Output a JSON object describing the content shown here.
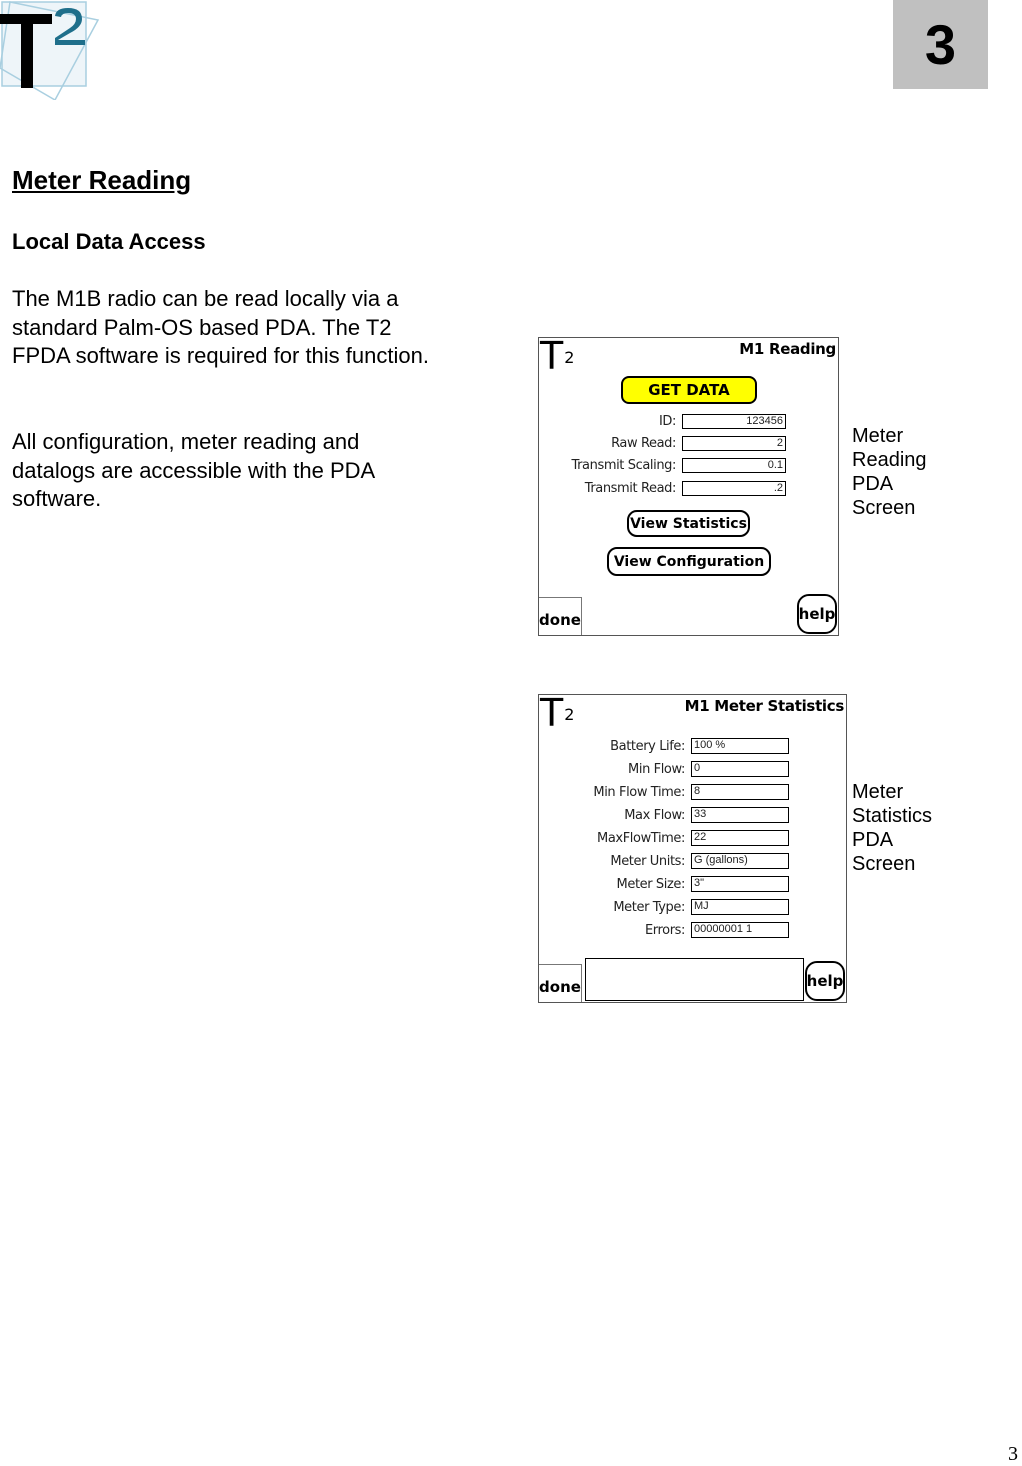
{
  "header": {
    "logo_text": "T",
    "logo_superscript": "2",
    "chapter_number": "3"
  },
  "section": {
    "title": "Meter Reading",
    "subtitle": "Local Data Access",
    "paragraphs": [
      "The M1B radio can be read locally via a standard Palm-OS based PDA. The T2 FPDA software is required for this function.",
      "All configuration, meter reading and datalogs are accessible with the PDA software."
    ]
  },
  "reading_screen": {
    "logo_text": "T",
    "logo_superscript": "2",
    "title": "M1 Reading",
    "get_data_label": "GET DATA",
    "fields": [
      {
        "label": "ID:",
        "value": "123456"
      },
      {
        "label": "Raw Read:",
        "value": "2"
      },
      {
        "label": "Transmit Scaling:",
        "value": "0.1"
      },
      {
        "label": "Transmit Read:",
        "value": ".2"
      }
    ],
    "view_statistics_label": "View Statistics",
    "view_configuration_label": "View Configuration",
    "done_label": "done",
    "help_label": "help",
    "caption": [
      "Meter",
      "Reading",
      "PDA",
      "Screen"
    ]
  },
  "statistics_screen": {
    "logo_text": "T",
    "logo_superscript": "2",
    "title": "M1 Meter Statistics",
    "fields": [
      {
        "label": "Battery Life:",
        "value": "100 %"
      },
      {
        "label": "Min Flow:",
        "value": " 0"
      },
      {
        "label": "Min Flow Time:",
        "value": " 8"
      },
      {
        "label": "Max Flow:",
        "value": " 33"
      },
      {
        "label": "MaxFlowTime:",
        "value": " 22"
      },
      {
        "label": "Meter Units:",
        "value": "G (gallons)"
      },
      {
        "label": "Meter Size:",
        "value": "3\""
      },
      {
        "label": "Meter Type:",
        "value": "MJ"
      },
      {
        "label": "Errors:",
        "value": "00000001 1"
      }
    ],
    "done_label": "done",
    "help_label": "help",
    "caption": [
      "Meter",
      "Statistics",
      "PDA",
      "Screen"
    ]
  },
  "footer": {
    "page_number": "3"
  },
  "colors": {
    "get_data_button": "#ffff00",
    "chapter_box": "#c0c0c0",
    "logo_teal": "#1f6f8b",
    "logo_frame": "#a9cfe0"
  }
}
